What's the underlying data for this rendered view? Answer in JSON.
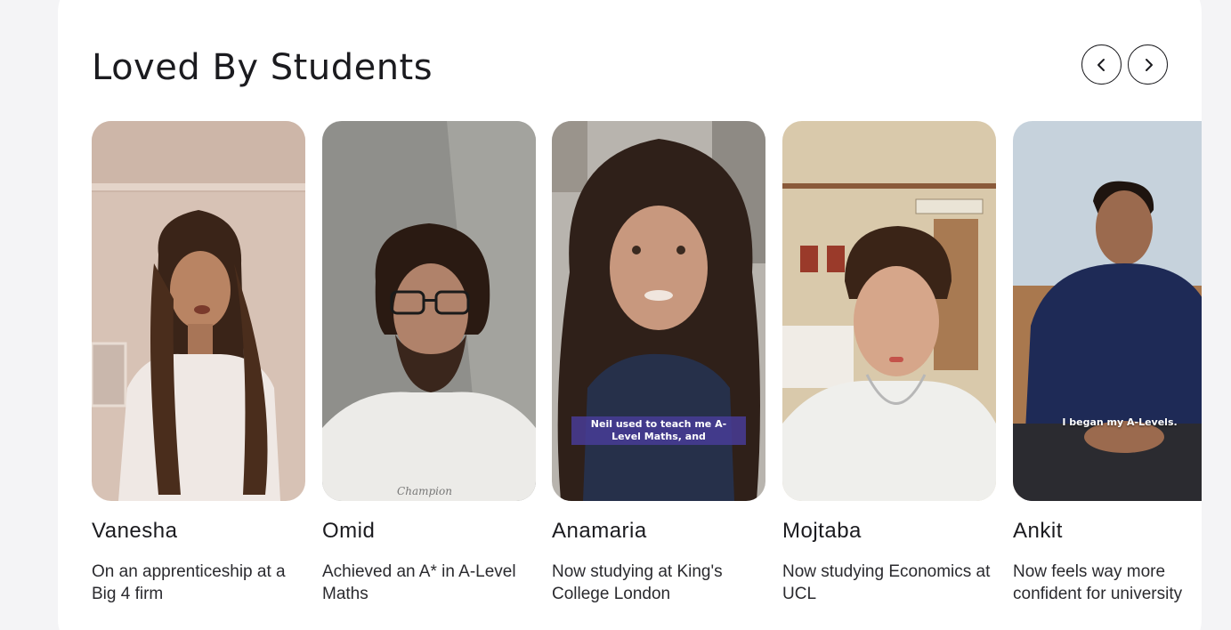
{
  "section": {
    "title": "Loved By Students",
    "prev_icon": "chevron-left-icon",
    "next_icon": "chevron-right-icon"
  },
  "testimonials": [
    {
      "name": "Vanesha",
      "description": "On an apprenticeship at a Big 4 firm",
      "caption": ""
    },
    {
      "name": "Omid",
      "description": "Achieved an A* in A-Level Maths",
      "caption": "",
      "shirt_text": "Champion"
    },
    {
      "name": "Anamaria",
      "description": "Now studying at King's College London",
      "caption": "Neil used to teach me A-Level Maths, and"
    },
    {
      "name": "Mojtaba",
      "description": "Now studying Economics at UCL",
      "caption": ""
    },
    {
      "name": "Ankit",
      "description": "Now feels way more confident for university",
      "caption": "I began my A-Levels."
    }
  ],
  "colors": {
    "caption_bg": "#4b3c96",
    "text": "#1b1b1f",
    "page_bg": "#f4f4f6"
  }
}
